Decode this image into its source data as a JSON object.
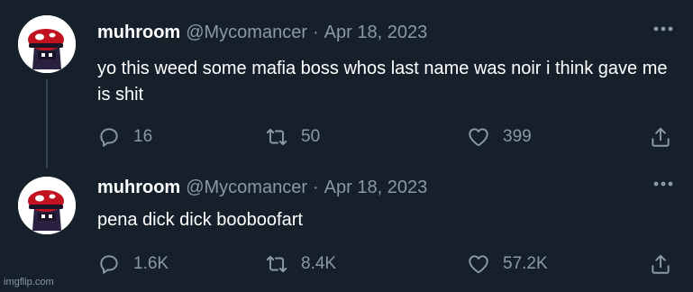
{
  "tweets": [
    {
      "display_name": "muhroom",
      "handle": "@Mycomancer",
      "separator": "·",
      "date": "Apr 18, 2023",
      "text": "yo this weed some mafia boss whos last name was noir i think gave me is shit",
      "replies": "16",
      "retweets": "50",
      "likes": "399"
    },
    {
      "display_name": "muhroom",
      "handle": "@Mycomancer",
      "separator": "·",
      "date": "Apr 18, 2023",
      "text": "pena dick dick booboofart",
      "replies": "1.6K",
      "retweets": "8.4K",
      "likes": "57.2K"
    }
  ],
  "icons": {
    "reply": "reply-icon",
    "retweet": "retweet-icon",
    "like": "heart-icon",
    "share": "share-icon",
    "more": "more-icon",
    "avatar": "mushroom-avatar"
  },
  "colors": {
    "background": "#15202b",
    "secondary_text": "#8b98a5",
    "thread_line": "#38444d",
    "avatar_cap": "#c1121f",
    "avatar_body": "#2a2140"
  },
  "watermark": "imgflip.com"
}
